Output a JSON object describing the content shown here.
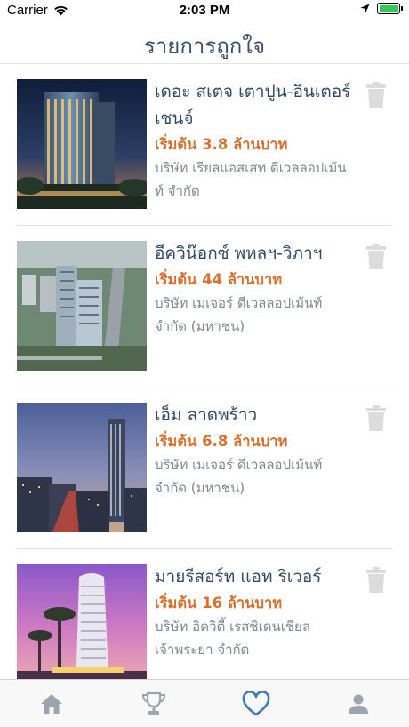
{
  "status_bar": {
    "carrier": "Carrier",
    "time": "2:03 PM"
  },
  "header": {
    "title": "รายการถูกใจ"
  },
  "favorites": [
    {
      "title": "เดอะ สเตจ เตาปูน-อินเตอร์เชนจ์",
      "price": "เริ่มต้น 3.8 ล้านบาท",
      "company": "บริษัท เรียลแอสเสท ดีเวลลอปเม้นท์ จำกัด"
    },
    {
      "title": "อีควิน๊อกซ์ พหลฯ-วิภาฯ",
      "price": "เริ่มต้น 44 ล้านบาท",
      "company": "บริษัท เมเจอร์ ดีเวลลอปเม้นท์ จำกัด (มหาชน)"
    },
    {
      "title": "เอ็ม ลาดพร้าว",
      "price": "เริ่มต้น 6.8 ล้านบาท",
      "company": "บริษัท เมเจอร์ ดีเวลลอปเม้นท์ จำกัด (มหาชน)"
    },
    {
      "title": "มายรีสอร์ท แอท ริเวอร์",
      "price": "เริ่มต้น 16 ล้านบาท",
      "company": "บริษัท อิควิตี้ เรสซิเดนเชียล เจ้าพระยา จำกัด"
    }
  ],
  "tabs": [
    {
      "icon": "home-icon",
      "active": false
    },
    {
      "icon": "trophy-icon",
      "active": false
    },
    {
      "icon": "heart-icon",
      "active": true
    },
    {
      "icon": "user-icon",
      "active": false
    }
  ],
  "colors": {
    "primary": "#2f4a66",
    "accent": "#3f7eb5",
    "price": "#d9702e",
    "muted": "#9aa5b0",
    "trash": "#dcdcdc"
  }
}
